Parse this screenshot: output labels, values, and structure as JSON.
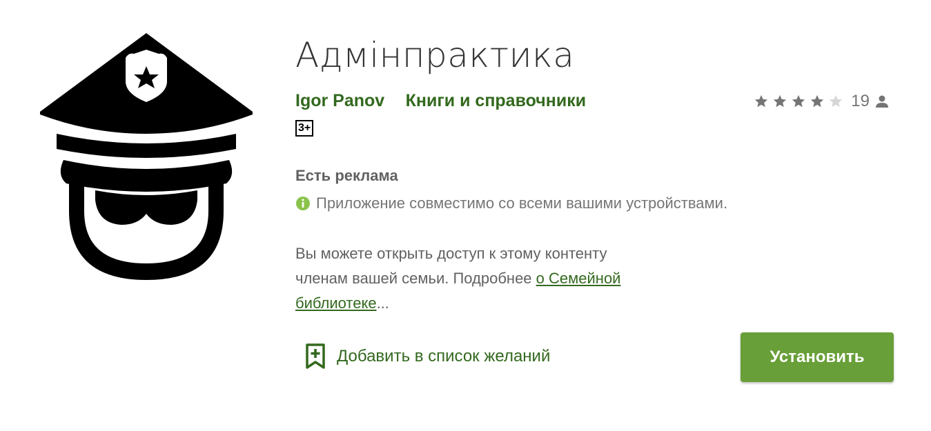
{
  "app": {
    "title": "Адмінпрактика",
    "developer": "Igor Panov",
    "category": "Книги и справочники",
    "content_rating": "3+",
    "icon": "police-officer-icon"
  },
  "rating": {
    "stars": 4,
    "max_stars": 5,
    "count": "19",
    "star_color": "#757575",
    "empty_star_color": "#d6d6d6"
  },
  "info": {
    "ads": "Есть реклама",
    "compatibility": "Приложение совместимо со всеми вашими устройствами.",
    "family_text": "Вы можете открыть доступ к этому контенту членам вашей семьи. Подробнее ",
    "family_link": "о Семейной библиотеке",
    "family_ellipsis": "..."
  },
  "actions": {
    "wishlist_label": "Добавить в список желаний",
    "install_label": "Установить"
  },
  "colors": {
    "accent_green": "#33691e",
    "button_green": "#689f38",
    "info_icon_green": "#8bc34a"
  }
}
